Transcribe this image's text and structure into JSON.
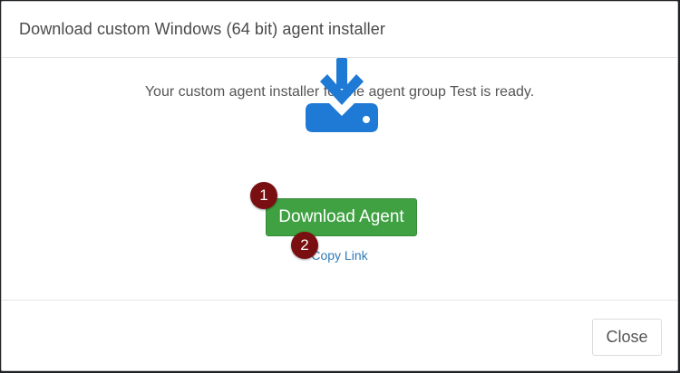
{
  "dialog": {
    "title": "Download custom Windows (64 bit) agent installer",
    "message": "Your custom agent installer for the agent group Test is ready.",
    "icon": "download-to-drive-icon",
    "download_button_label": "Download Agent",
    "copy_link_label": "Copy Link",
    "close_button_label": "Close"
  },
  "annotations": {
    "badge_1": "1",
    "badge_2": "2"
  },
  "colors": {
    "accent_icon": "#1f7ad6",
    "download_button": "#3fa142",
    "link": "#2f7ab8",
    "badge": "#7a0f12"
  }
}
